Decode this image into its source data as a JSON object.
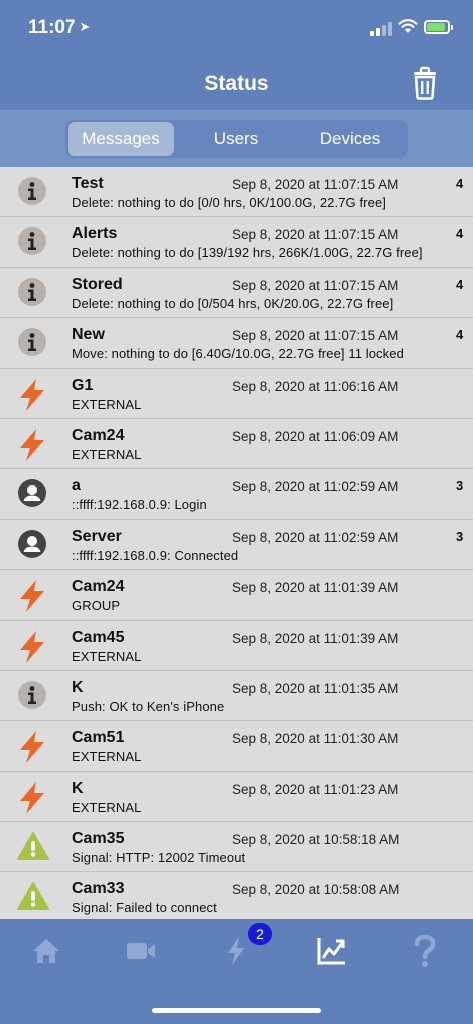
{
  "status_bar": {
    "time": "11:07",
    "location_arrow": "➤"
  },
  "nav": {
    "title": "Status",
    "trash_icon": "trash-icon"
  },
  "segments": [
    {
      "label": "Messages",
      "active": true
    },
    {
      "label": "Users",
      "active": false
    },
    {
      "label": "Devices",
      "active": false
    }
  ],
  "rows": [
    {
      "icon": "info",
      "title": "Test",
      "time": "Sep 8, 2020 at 11:07:15 AM",
      "detail": "Delete: nothing to do [0/0 hrs, 0K/100.0G, 22.7G free]",
      "badge": "4"
    },
    {
      "icon": "info",
      "title": "Alerts",
      "time": "Sep 8, 2020 at 11:07:15 AM",
      "detail": "Delete: nothing to do [139/192 hrs, 266K/1.00G, 22.7G free]",
      "badge": "4"
    },
    {
      "icon": "info",
      "title": "Stored",
      "time": "Sep 8, 2020 at 11:07:15 AM",
      "detail": "Delete: nothing to do [0/504 hrs, 0K/20.0G, 22.7G free]",
      "badge": "4"
    },
    {
      "icon": "info",
      "title": "New",
      "time": "Sep 8, 2020 at 11:07:15 AM",
      "detail": "Move: nothing to do [6.40G/10.0G, 22.7G free] 11 locked",
      "badge": "4"
    },
    {
      "icon": "bolt",
      "title": "G1",
      "time": "Sep 8, 2020 at 11:06:16 AM",
      "detail": "EXTERNAL",
      "badge": ""
    },
    {
      "icon": "bolt",
      "title": "Cam24",
      "time": "Sep 8, 2020 at 11:06:09 AM",
      "detail": "EXTERNAL",
      "badge": ""
    },
    {
      "icon": "user",
      "title": "a",
      "time": "Sep 8, 2020 at 11:02:59 AM",
      "detail": "::ffff:192.168.0.9: Login",
      "badge": "3"
    },
    {
      "icon": "user",
      "title": "Server",
      "time": "Sep 8, 2020 at 11:02:59 AM",
      "detail": "::ffff:192.168.0.9: Connected",
      "badge": "3"
    },
    {
      "icon": "bolt",
      "title": "Cam24",
      "time": "Sep 8, 2020 at 11:01:39 AM",
      "detail": "GROUP",
      "badge": ""
    },
    {
      "icon": "bolt",
      "title": "Cam45",
      "time": "Sep 8, 2020 at 11:01:39 AM",
      "detail": "EXTERNAL",
      "badge": ""
    },
    {
      "icon": "info",
      "title": "K",
      "time": "Sep 8, 2020 at 11:01:35 AM",
      "detail": "Push: OK to Ken's iPhone",
      "badge": ""
    },
    {
      "icon": "bolt",
      "title": "Cam51",
      "time": "Sep 8, 2020 at 11:01:30 AM",
      "detail": "EXTERNAL",
      "badge": ""
    },
    {
      "icon": "bolt",
      "title": "K",
      "time": "Sep 8, 2020 at 11:01:23 AM",
      "detail": "EXTERNAL",
      "badge": ""
    },
    {
      "icon": "warning",
      "title": "Cam35",
      "time": "Sep 8, 2020 at 10:58:18 AM",
      "detail": "Signal: HTTP: 12002 Timeout",
      "badge": ""
    },
    {
      "icon": "warning",
      "title": "Cam33",
      "time": "Sep 8, 2020 at 10:58:08 AM",
      "detail": "Signal: Failed to connect",
      "badge": ""
    }
  ],
  "tabbar": {
    "tabs": [
      {
        "icon": "home-icon",
        "active": false
      },
      {
        "icon": "camera-icon",
        "active": false
      },
      {
        "icon": "bolt-icon",
        "active": false
      },
      {
        "icon": "chart-icon",
        "active": true
      },
      {
        "icon": "help-icon",
        "active": false
      }
    ],
    "alerts_badge": "2"
  },
  "colors": {
    "bar": "#5f80b9",
    "segment_bar": "#7494c5",
    "list_bg": "#dcdcdc",
    "bolt": "#e8682a",
    "warning": "#a5c446",
    "info_circle": "#b8b0ab",
    "user_circle": "#444444",
    "badge": "#1a1ad6"
  }
}
